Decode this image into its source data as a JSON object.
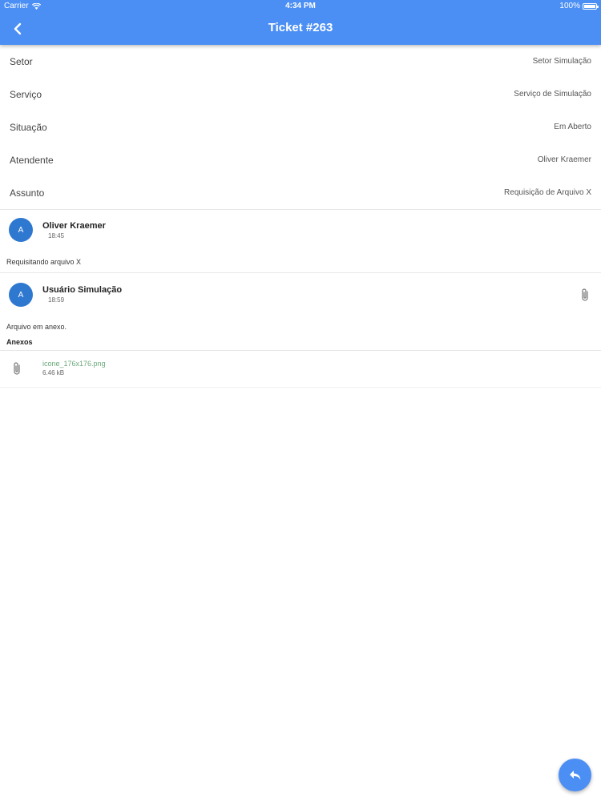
{
  "status_bar": {
    "carrier": "Carrier",
    "time": "4:34 PM",
    "battery": "100%",
    "icons": {
      "wifi": "wifi-icon",
      "battery": "battery-icon"
    }
  },
  "header": {
    "title": "Ticket #263",
    "back_icon": "chevron-left-icon",
    "color": "#4b8ff5"
  },
  "details": [
    {
      "label": "Setor",
      "value": "Setor Simulação"
    },
    {
      "label": "Serviço",
      "value": "Serviço de Simulação"
    },
    {
      "label": "Situação",
      "value": "Em Aberto"
    },
    {
      "label": "Atendente",
      "value": "Oliver Kraemer"
    },
    {
      "label": "Assunto",
      "value": "Requisição de Arquivo X"
    }
  ],
  "messages": [
    {
      "avatar": "A",
      "author": "Oliver Kraemer",
      "time": "18:45",
      "text": "Requisitando arquivo X",
      "has_attachment": false
    },
    {
      "avatar": "A",
      "author": "Usuário Simulação",
      "time": "18:59",
      "text": "Arquivo em anexo.",
      "has_attachment": true,
      "attachments_title": "Anexos",
      "attachments": [
        {
          "name": "icone_176x176.png",
          "size": "6.46 kB",
          "icon": "paperclip-icon"
        }
      ]
    }
  ],
  "fab": {
    "icon": "reply-icon",
    "color": "#4b8ff5"
  },
  "colors": {
    "avatar": "#2f78d0",
    "attachment_link": "#6aa87a"
  }
}
